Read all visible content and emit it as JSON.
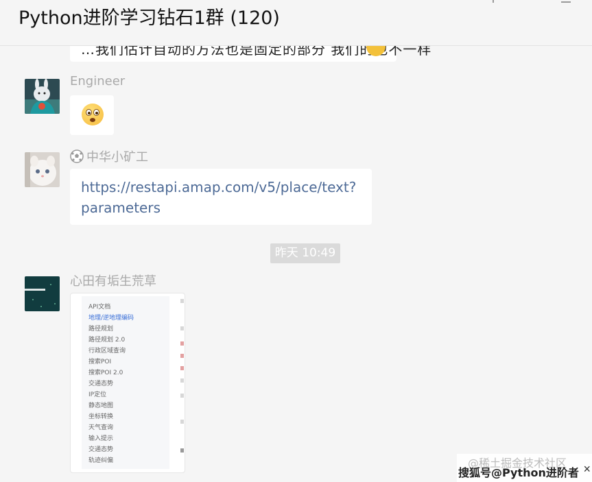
{
  "header": {
    "title": "Python进阶学习钻石1群 (120)"
  },
  "messages": {
    "partial": {
      "text": "…我们估计自动的方法也是固定的部分 我们的也不一样"
    },
    "engineer": {
      "sender": "Engineer",
      "emoji": "flushed-face-emoji"
    },
    "kuanggong": {
      "sender_icon": "soccer-ball-icon",
      "sender": "中华小矿工",
      "link": "https://restapi.amap.com/v5/place/text?parameters"
    },
    "time_divider": "昨天 10:49",
    "xintian": {
      "sender": "心田有垢生荒草",
      "image_menu": {
        "items": [
          "API文档",
          "地理/逆地理编码",
          "路径规划",
          "路径规划 2.0",
          "行政区域查询",
          "搜索POI",
          "搜索POI 2.0",
          "交通态势",
          "IP定位",
          "静态地图",
          "坐标转换",
          "天气查询",
          "输入提示",
          "交通态势",
          "轨迹纠偏"
        ],
        "active_index": 1
      }
    }
  },
  "watermark": {
    "line1": "@稀土掘金技术社区",
    "line2": "搜狐号@Python进阶者",
    "close": "×"
  },
  "colors": {
    "background": "#f5f5f5",
    "bubble": "#ffffff",
    "link": "#4d6a96",
    "sender": "#a9a9a9",
    "time_badge": "#dadada"
  }
}
